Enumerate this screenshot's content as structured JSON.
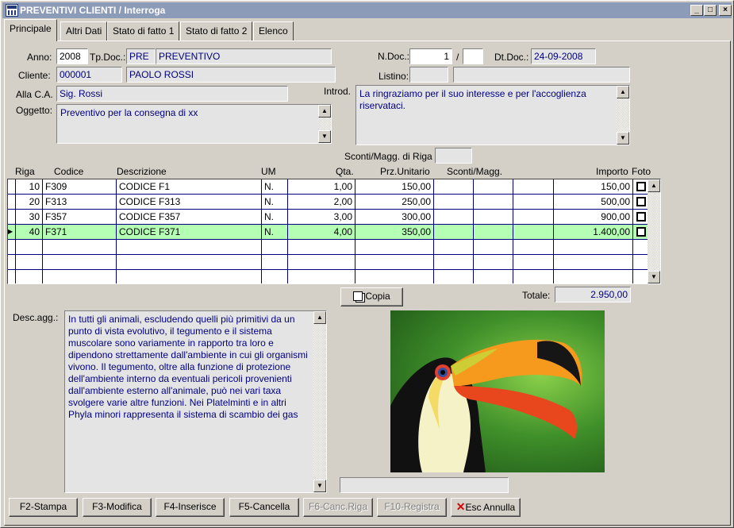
{
  "window": {
    "title": "PREVENTIVI CLIENTI / Interroga"
  },
  "tabs": [
    "Principale",
    "Altri Dati",
    "Stato di fatto 1",
    "Stato di fatto 2",
    "Elenco"
  ],
  "form": {
    "anno_label": "Anno:",
    "anno": "2008",
    "tpdoc_label": "Tp.Doc.:",
    "tpdoc_code": "PRE",
    "tpdoc_desc": "PREVENTIVO",
    "ndoc_label": "N.Doc.:",
    "ndoc": "1",
    "ndoc_sep": "/",
    "ndoc_suffix": "",
    "dtdoc_label": "Dt.Doc.:",
    "dtdoc": "24-09-2008",
    "cliente_label": "Cliente:",
    "cliente_code": "000001",
    "cliente_name": "PAOLO ROSSI",
    "listino_label": "Listino:",
    "listino_code": "",
    "listino_desc": "",
    "alla_ca_label": "Alla C.A.",
    "alla_ca": "Sig. Rossi",
    "introd_label": "Introd.",
    "introd": "La ringraziamo per il suo interesse e per l'accoglienza riservataci.",
    "oggetto_label": "Oggetto:",
    "oggetto": "Preventivo per la consegna di xx",
    "sconti_riga_label": "Sconti/Magg. di Riga",
    "sconti_riga": ""
  },
  "grid": {
    "headers": {
      "riga": "Riga",
      "codice": "Codice",
      "descrizione": "Descrizione",
      "um": "UM",
      "qta": "Qta.",
      "prezzo": "Prz.Unitario",
      "sconti": "Sconti/Magg.",
      "importo": "Importo",
      "foto": "Foto"
    },
    "rows": [
      {
        "riga": "10",
        "codice": "F309",
        "descrizione": "CODICE F1",
        "um": "N.",
        "qta": "1,00",
        "prezzo": "150,00",
        "importo": "150,00"
      },
      {
        "riga": "20",
        "codice": "F313",
        "descrizione": "CODICE F313",
        "um": "N.",
        "qta": "2,00",
        "prezzo": "250,00",
        "importo": "500,00"
      },
      {
        "riga": "30",
        "codice": "F357",
        "descrizione": "CODICE F357",
        "um": "N.",
        "qta": "3,00",
        "prezzo": "300,00",
        "importo": "900,00"
      },
      {
        "riga": "40",
        "codice": "F371",
        "descrizione": "CODICE F371",
        "um": "N.",
        "qta": "4,00",
        "prezzo": "350,00",
        "importo": "1.400,00"
      }
    ],
    "selected_row": 3
  },
  "copia_label": "Copia",
  "totale_label": "Totale:",
  "totale": "2.950,00",
  "desc_agg_label": "Desc.agg.:",
  "desc_agg": "In tutti gli animali, escludendo quelli più primitivi da un punto di vista evolutivo, il tegumento e il sistema muscolare sono variamente in rapporto tra loro e dipendono strettamente dall'ambiente in cui gli organismi vivono. Il tegumento, oltre alla funzione di protezione dell'ambiente interno da eventuali pericoli provenienti dall'ambiente esterno all'animale, può nei vari taxa svolgere varie altre funzioni. Nei Platelminti e in altri Phyla minori rappresenta il sistema di scambio dei gas",
  "photo_caption": "",
  "buttons": {
    "stampa": "F2-Stampa",
    "modifica": "F3-Modifica",
    "inserisce": "F4-Inserisce",
    "cancella": "F5-Cancella",
    "canc_riga": "F6-Canc.Riga",
    "registra": "F10-Registra",
    "annulla": "Esc Annulla"
  },
  "colors": {
    "selected_row": "#b4ffb4",
    "field_text": "#000080",
    "window_bg": "#d4d0c8"
  }
}
